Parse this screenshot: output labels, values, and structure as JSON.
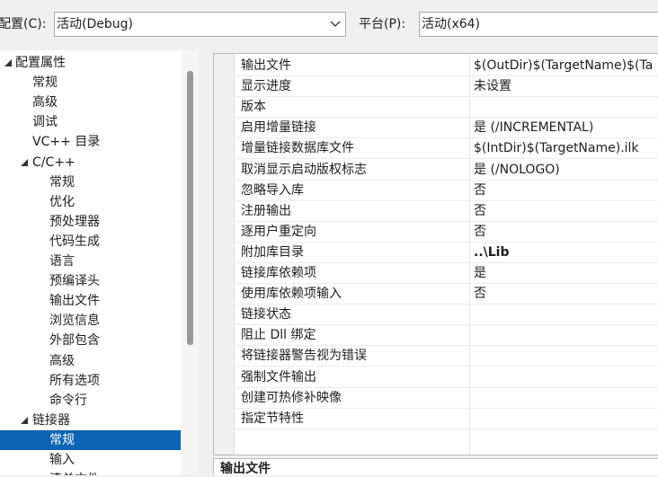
{
  "topbar": {
    "config_label": "配置(C):",
    "config_value": "活动(Debug)",
    "platform_label": "平台(P):",
    "platform_value": "活动(x64)"
  },
  "tree": {
    "items": [
      {
        "label": "配置属性",
        "indent": 0,
        "expanded": true
      },
      {
        "label": "常规",
        "indent": 1
      },
      {
        "label": "高级",
        "indent": 1
      },
      {
        "label": "调试",
        "indent": 1
      },
      {
        "label": "VC++ 目录",
        "indent": 1
      },
      {
        "label": "C/C++",
        "indent": 1,
        "expanded": true
      },
      {
        "label": "常规",
        "indent": 2
      },
      {
        "label": "优化",
        "indent": 2
      },
      {
        "label": "预处理器",
        "indent": 2
      },
      {
        "label": "代码生成",
        "indent": 2
      },
      {
        "label": "语言",
        "indent": 2
      },
      {
        "label": "预编译头",
        "indent": 2
      },
      {
        "label": "输出文件",
        "indent": 2
      },
      {
        "label": "浏览信息",
        "indent": 2
      },
      {
        "label": "外部包含",
        "indent": 2
      },
      {
        "label": "高级",
        "indent": 2
      },
      {
        "label": "所有选项",
        "indent": 2
      },
      {
        "label": "命令行",
        "indent": 2
      },
      {
        "label": "链接器",
        "indent": 1,
        "expanded": true
      },
      {
        "label": "常规",
        "indent": 2,
        "selected": true
      },
      {
        "label": "输入",
        "indent": 2
      },
      {
        "label": "清单文件",
        "indent": 2
      }
    ]
  },
  "properties": [
    {
      "name": "输出文件",
      "value": "$(OutDir)$(TargetName)$(Ta"
    },
    {
      "name": "显示进度",
      "value": "未设置"
    },
    {
      "name": "版本",
      "value": ""
    },
    {
      "name": "启用增量链接",
      "value": "是 (/INCREMENTAL)"
    },
    {
      "name": "增量链接数据库文件",
      "value": "$(IntDir)$(TargetName).ilk"
    },
    {
      "name": "取消显示启动版权标志",
      "value": "是 (/NOLOGO)"
    },
    {
      "name": "忽略导入库",
      "value": "否"
    },
    {
      "name": "注册输出",
      "value": "否"
    },
    {
      "name": "逐用户重定向",
      "value": "否"
    },
    {
      "name": "附加库目录",
      "value": "..\\Lib",
      "bold": true
    },
    {
      "name": "链接库依赖项",
      "value": "是"
    },
    {
      "name": "使用库依赖项输入",
      "value": "否"
    },
    {
      "name": "链接状态",
      "value": ""
    },
    {
      "name": "阻止 Dll 绑定",
      "value": ""
    },
    {
      "name": "将链接器警告视为错误",
      "value": ""
    },
    {
      "name": "强制文件输出",
      "value": ""
    },
    {
      "name": "创建可热修补映像",
      "value": ""
    },
    {
      "name": "指定节特性",
      "value": ""
    }
  ],
  "description": {
    "title": "输出文件"
  },
  "colors": {
    "selection": "#0b64b4",
    "window_bg": "#f0f0f0",
    "panel_bg": "#ffffff"
  }
}
